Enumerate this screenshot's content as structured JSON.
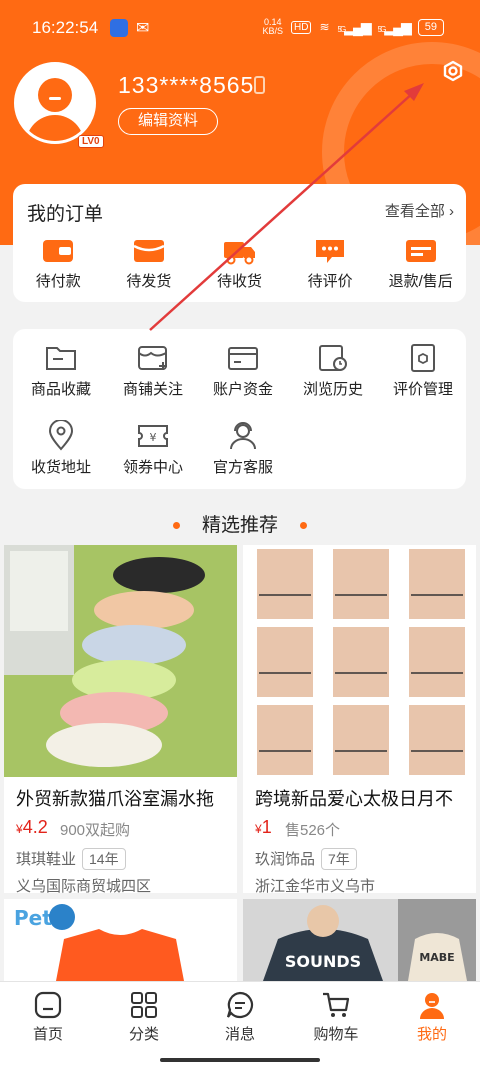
{
  "status_bar": {
    "time": "16:22:54",
    "net_speed": "0.14",
    "net_unit": "KB/S",
    "hd": "HD",
    "signal1": "5G",
    "signal2": "5G",
    "battery": "59"
  },
  "profile": {
    "phone": "133****8565",
    "edit_label": "编辑资料",
    "level": "LV0"
  },
  "orders": {
    "title": "我的订单",
    "view_all": "查看全部",
    "items": [
      {
        "label": "待付款",
        "icon": "wallet-icon"
      },
      {
        "label": "待发货",
        "icon": "package-icon"
      },
      {
        "label": "待收货",
        "icon": "truck-icon"
      },
      {
        "label": "待评价",
        "icon": "comment-icon"
      },
      {
        "label": "退款/售后",
        "icon": "refund-icon"
      }
    ]
  },
  "tools": {
    "items": [
      {
        "label": "商品收藏",
        "icon": "folder-icon"
      },
      {
        "label": "商铺关注",
        "icon": "shop-follow-icon"
      },
      {
        "label": "账户资金",
        "icon": "card-icon"
      },
      {
        "label": "浏览历史",
        "icon": "history-icon"
      },
      {
        "label": "评价管理",
        "icon": "review-icon"
      },
      {
        "label": "收货地址",
        "icon": "location-icon"
      },
      {
        "label": "领券中心",
        "icon": "coupon-icon"
      },
      {
        "label": "官方客服",
        "icon": "service-icon"
      }
    ]
  },
  "recommend": {
    "title": "精选推荐"
  },
  "products": [
    {
      "title": "外贸新款猫爪浴室漏水拖",
      "currency": "¥",
      "price": "4.2",
      "sold": "900双起购",
      "shop": "琪琪鞋业",
      "years": "14年",
      "location": "义乌国际商贸城四区"
    },
    {
      "title": "跨境新品爱心太极日月不",
      "currency": "¥",
      "price": "1",
      "sold": "售526个",
      "shop": "玖润饰品",
      "years": "7年",
      "location": "浙江金华市义乌市"
    }
  ],
  "tabbar": {
    "items": [
      {
        "label": "首页",
        "icon": "home-icon"
      },
      {
        "label": "分类",
        "icon": "category-icon"
      },
      {
        "label": "消息",
        "icon": "message-icon"
      },
      {
        "label": "购物车",
        "icon": "cart-icon"
      },
      {
        "label": "我的",
        "icon": "profile-icon"
      }
    ],
    "active_index": 4
  },
  "colors": {
    "brand": "#ff6a13",
    "price": "#e2231a",
    "annotation_arrow": "#e23b3b"
  }
}
